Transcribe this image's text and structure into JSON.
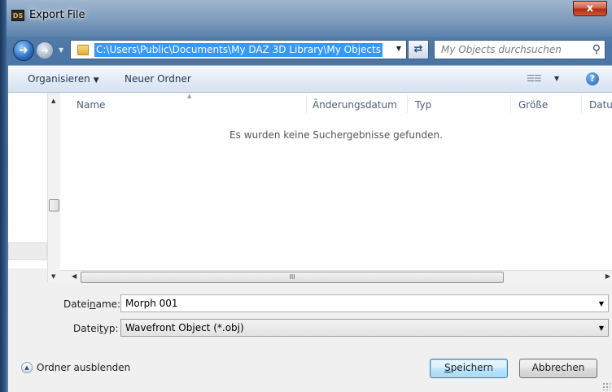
{
  "window": {
    "logo_text": "DS",
    "title": "Export File",
    "close_label": "x"
  },
  "navigation": {
    "address": "C:\\Users\\Public\\Documents\\My DAZ 3D Library\\My Objects",
    "search_placeholder": "My Objects durchsuchen"
  },
  "toolbar": {
    "organize_label": "Organisieren",
    "new_folder_label": "Neuer Ordner"
  },
  "file_list": {
    "columns": [
      "Name",
      "Änderungsdatum",
      "Typ",
      "Größe",
      "Datum"
    ],
    "empty_message": "Es wurden keine Suchergebnisse gefunden.",
    "hscroll_label": "III"
  },
  "form": {
    "filename_label_pre": "Datei",
    "filename_label_key": "n",
    "filename_label_post": "ame:",
    "filename_value": "Morph 001",
    "filetype_label_pre": "Datei",
    "filetype_label_key": "t",
    "filetype_label_post": "yp:",
    "filetype_value": "Wavefront Object (*.obj)"
  },
  "footer": {
    "hide_folders_label": "Ordner ausblenden",
    "save_key": "S",
    "save_rest": "peichern",
    "cancel_label": "Abbrechen"
  }
}
